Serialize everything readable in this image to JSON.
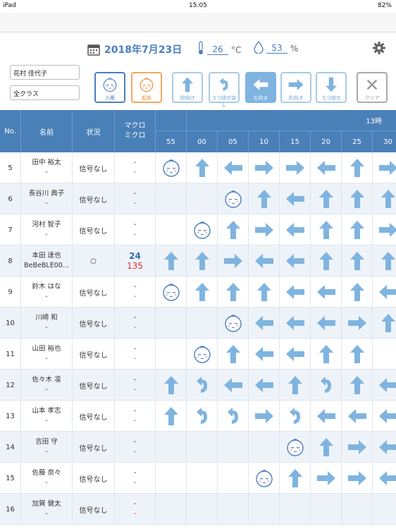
{
  "status_bar": {
    "carrier": "iPad",
    "time": "15:05",
    "battery": "82%"
  },
  "header": {
    "date": "2018年7月23日",
    "temperature": "26",
    "temp_unit": "°C",
    "humidity": "53",
    "humidity_unit": "%"
  },
  "filters": {
    "teacher": "花村 佳代子",
    "class": "全クラス"
  },
  "actions": [
    {
      "key": "sleep",
      "label": "入眠",
      "icon": "baby",
      "selected": false
    },
    {
      "key": "wake",
      "label": "起床",
      "icon": "baby",
      "selected": false
    },
    {
      "key": "up",
      "label": "仰向け",
      "icon": "up",
      "selected": false
    },
    {
      "key": "turn",
      "label": "うつ伏せ戻し",
      "icon": "turn",
      "selected": false
    },
    {
      "key": "left",
      "label": "左向き",
      "icon": "left",
      "selected": true
    },
    {
      "key": "right",
      "label": "右向き",
      "icon": "right",
      "selected": false
    },
    {
      "key": "down",
      "label": "うつ伏せ",
      "icon": "down",
      "selected": false
    },
    {
      "key": "clear",
      "label": "クリア",
      "icon": "x",
      "selected": false
    }
  ],
  "table": {
    "col_no": "No.",
    "col_name": "名前",
    "col_status": "状況",
    "col_sensor": "マクロ\nミクロ",
    "hour_label": "13時",
    "times": [
      "55",
      "00",
      "05",
      "10",
      "15",
      "20",
      "25",
      "30"
    ],
    "rows": [
      {
        "no": "5",
        "name": "田中 裕太",
        "sub": "-",
        "status": "信号なし",
        "macro": "-",
        "micro": "-",
        "cells": [
          "baby",
          "up",
          "left",
          "right",
          "right",
          "left",
          "up",
          "right"
        ]
      },
      {
        "no": "6",
        "name": "長谷川 典子",
        "sub": "-",
        "status": "信号なし",
        "macro": "-",
        "micro": "-",
        "cells": [
          "",
          "",
          "baby",
          "up",
          "left",
          "up",
          "up",
          "up"
        ]
      },
      {
        "no": "7",
        "name": "河村 智子",
        "sub": "-",
        "status": "信号なし",
        "macro": "-",
        "micro": "-",
        "cells": [
          "",
          "baby",
          "up",
          "right",
          "left",
          "up",
          "up",
          "right"
        ]
      },
      {
        "no": "8",
        "name": "本田 達也",
        "sub": "BeBeBLE00...",
        "status": "○",
        "macro": "24",
        "micro": "135",
        "cells": [
          "up",
          "up",
          "right",
          "left",
          "left",
          "up",
          "up",
          "up"
        ]
      },
      {
        "no": "9",
        "name": "鈴木 はな",
        "sub": "-",
        "status": "信号なし",
        "macro": "-",
        "micro": "-",
        "cells": [
          "baby",
          "up",
          "up",
          "up",
          "left",
          "left",
          "up",
          "left"
        ]
      },
      {
        "no": "10",
        "name": "川崎 和",
        "sub": "-",
        "status": "信号なし",
        "macro": "-",
        "micro": "-",
        "cells": [
          "",
          "",
          "baby",
          "left",
          "left",
          "left",
          "right",
          "up"
        ]
      },
      {
        "no": "11",
        "name": "山田 裕也",
        "sub": "-",
        "status": "信号なし",
        "macro": "-",
        "micro": "-",
        "cells": [
          "",
          "baby",
          "up",
          "left",
          "left",
          "up",
          "up",
          ""
        ]
      },
      {
        "no": "12",
        "name": "佐々木 凛",
        "sub": "-",
        "status": "信号なし",
        "macro": "-",
        "micro": "-",
        "cells": [
          "up",
          "turn",
          "left",
          "left",
          "up",
          "turn",
          "up",
          "left"
        ]
      },
      {
        "no": "13",
        "name": "山本 孝志",
        "sub": "-",
        "status": "信号なし",
        "macro": "-",
        "micro": "-",
        "cells": [
          "up",
          "turn",
          "turn",
          "right",
          "turn",
          "left",
          "left",
          "left"
        ]
      },
      {
        "no": "14",
        "name": "吉田 守",
        "sub": "-",
        "status": "信号なし",
        "macro": "-",
        "micro": "-",
        "cells": [
          "",
          "",
          "",
          "",
          "baby",
          "up",
          "right",
          "left"
        ]
      },
      {
        "no": "15",
        "name": "佐藤 奈々",
        "sub": "-",
        "status": "信号なし",
        "macro": "-",
        "micro": "-",
        "cells": [
          "",
          "",
          "",
          "baby",
          "up",
          "right",
          "right",
          "left"
        ]
      },
      {
        "no": "16",
        "name": "加賀 健太",
        "sub": "-",
        "status": "信号なし",
        "macro": "-",
        "micro": "-",
        "cells": [
          "",
          "",
          "",
          "",
          "",
          "",
          "",
          ""
        ]
      }
    ]
  },
  "colors": {
    "accent": "#4a7fc0",
    "arrow": "#7fb4e0",
    "header_bg": "#4a80b8",
    "micro": "#e03030"
  }
}
